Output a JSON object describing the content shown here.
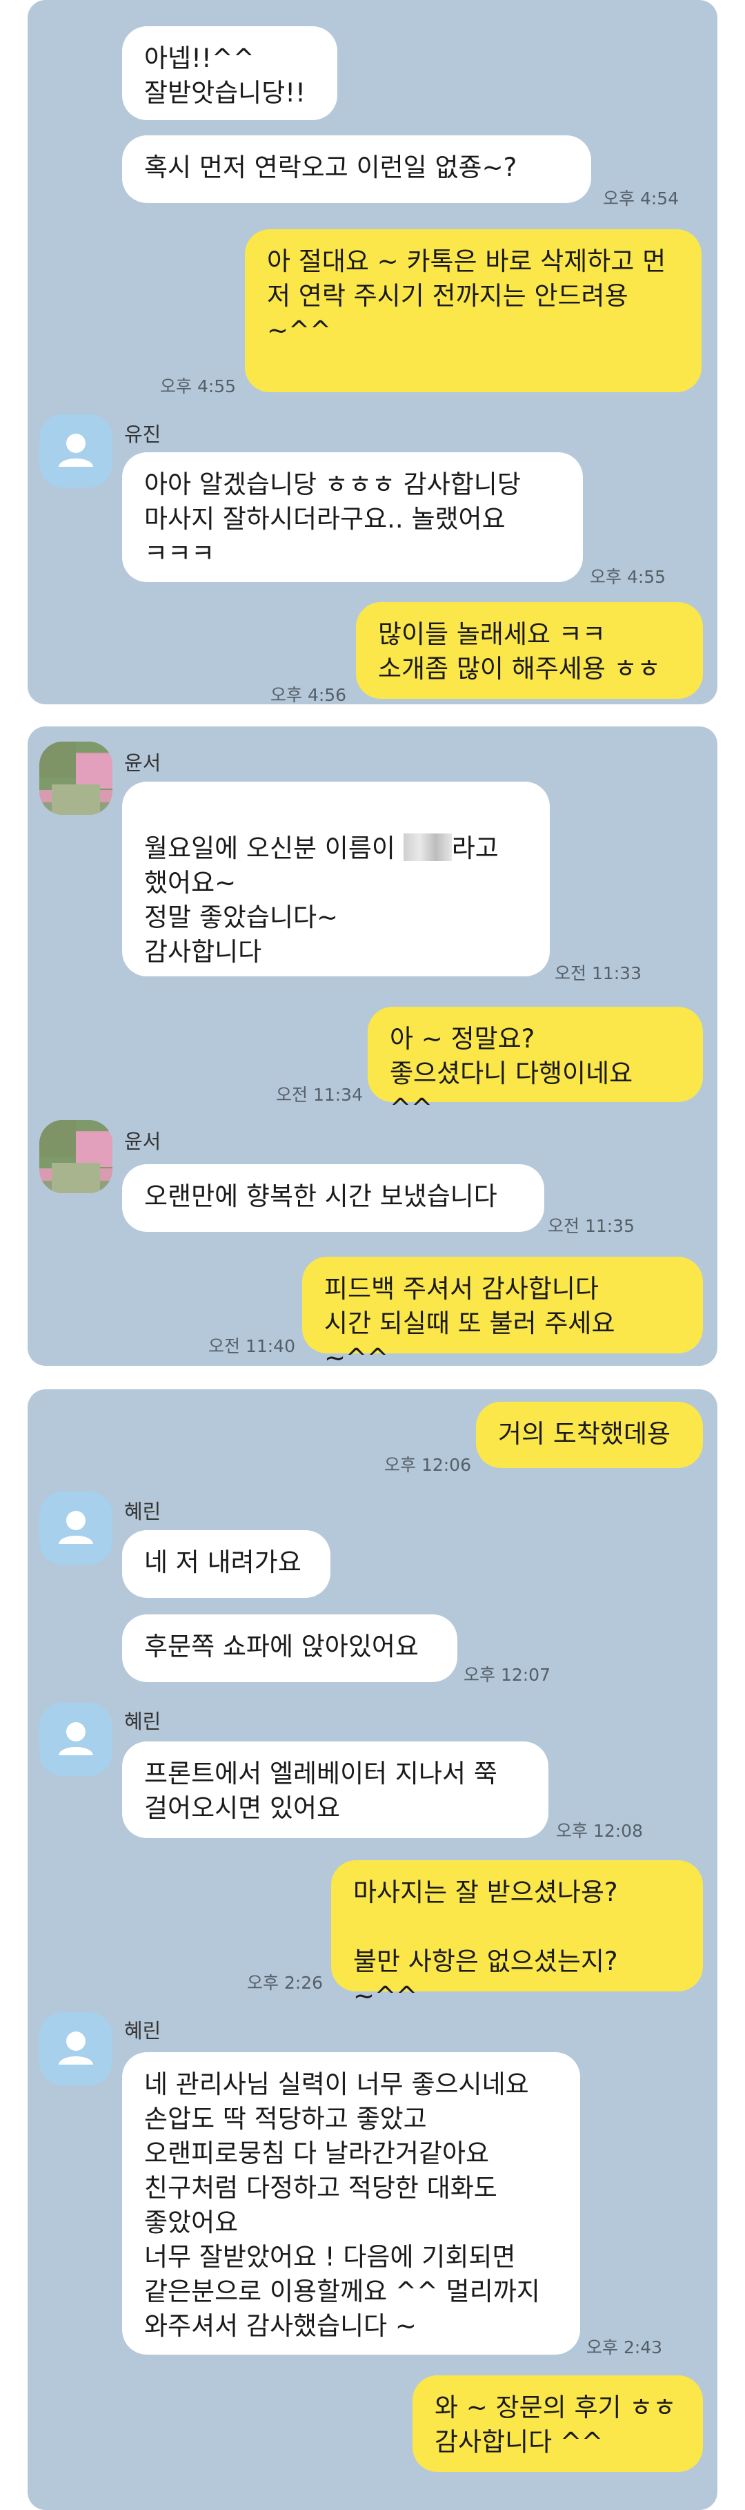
{
  "panel1": {
    "bubble_top1": "아넵!!^^\n잘받앗습니당!!",
    "bubble_top2": "혹시 먼저 연락오고 이런일 없죵~?",
    "time_top2": "오후 4:54",
    "out1": "아 절대요 ~\n카톡은 바로 삭제하고\n먼저 연락 주시기 전까지는 안드려용 ~^^",
    "time_out1": "오후 4:55",
    "sender_name": "유진",
    "in1": "아아 알겠습니당 ㅎㅎㅎ 감사합니당\n마사지 잘하시더라구요.. 놀랬어요\nㅋㅋㅋ",
    "time_in1": "오후 4:55",
    "out2": "많이들 놀래세요 ㅋㅋ\n소개좀 많이 해주세용 ㅎㅎ",
    "time_out2": "오후 4:56"
  },
  "panel2": {
    "sender_name": "윤서",
    "in1_part1": "월요일에 오신분 이름이 ",
    "in1_part2": "라고\n했어요~\n정말 좋았습니다~\n감사합니다",
    "time_in1": "오전 11:33",
    "out1": "아 ~ 정말요?\n좋으셨다니 다행이네요 ^^",
    "time_out1": "오전 11:34",
    "sender_name2": "윤서",
    "in2": "오랜만에 향복한 시간 보냈습니다",
    "time_in2": "오전 11:35",
    "out2": "피드백 주셔서 감사합니다\n시간 되실때 또 불러 주세요 ~^^",
    "time_out2": "오전 11:40"
  },
  "panel3": {
    "out1": "거의 도착했데용",
    "time_out1": "오후 12:06",
    "sender_name1": "혜린",
    "in1": "네 저 내려가요",
    "in2": "후문쪽 쇼파에 앉아있어요",
    "time_in2": "오후 12:07",
    "sender_name2": "혜린",
    "in3": "프론트에서 엘레베이터 지나서 쭉\n걸어오시면 있어요",
    "time_in3": "오후 12:08",
    "out2": "마사지는 잘 받으셨나용?\n\n불만 사항은 없으셨는지? ~^^",
    "time_out2": "오후 2:26",
    "sender_name3": "혜린",
    "in4": "네 관리사님 실력이 너무 좋으시네요\n손압도 딱 적당하고 좋았고\n오랜피로뭉침 다 날라간거같아요\n친구처럼 다정하고 적당한 대화도\n좋았어요\n너무 잘받았어요 ! 다음에 기회되면\n같은분으로 이용할께요 ^^ 멀리까지\n와주셔서 감사했습니다 ~",
    "time_in4": "오후 2:43",
    "out3": "와 ~ 장문의 후기 ㅎㅎ\n감사합니다 ^^"
  },
  "colors": {
    "panel_bg": "#b5c8d9",
    "outgoing_bubble": "#fbe74a",
    "incoming_bubble": "#ffffff"
  }
}
